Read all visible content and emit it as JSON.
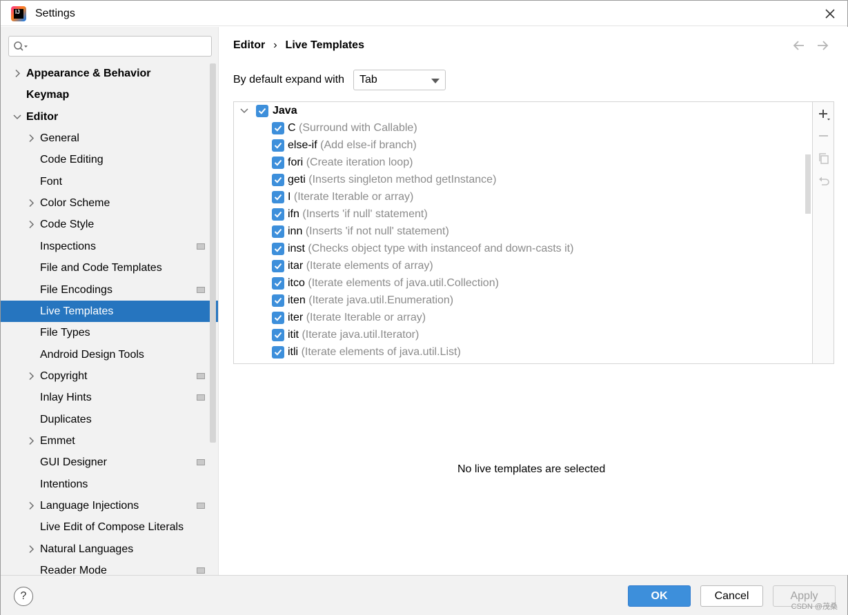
{
  "window": {
    "title": "Settings"
  },
  "sidebar": {
    "search_placeholder": "",
    "items": [
      {
        "label": "Appearance & Behavior",
        "bold": true,
        "expandable": true,
        "expanded": false,
        "level": 0,
        "has_project_icon": false
      },
      {
        "label": "Keymap",
        "bold": true,
        "expandable": false,
        "level": 0,
        "has_project_icon": false
      },
      {
        "label": "Editor",
        "bold": true,
        "expandable": true,
        "expanded": true,
        "level": 0,
        "has_project_icon": false
      },
      {
        "label": "General",
        "bold": false,
        "expandable": true,
        "expanded": false,
        "level": 1,
        "has_project_icon": false
      },
      {
        "label": "Code Editing",
        "bold": false,
        "expandable": false,
        "level": 1,
        "has_project_icon": false
      },
      {
        "label": "Font",
        "bold": false,
        "expandable": false,
        "level": 1,
        "has_project_icon": false
      },
      {
        "label": "Color Scheme",
        "bold": false,
        "expandable": true,
        "expanded": false,
        "level": 1,
        "has_project_icon": false
      },
      {
        "label": "Code Style",
        "bold": false,
        "expandable": true,
        "expanded": false,
        "level": 1,
        "has_project_icon": false
      },
      {
        "label": "Inspections",
        "bold": false,
        "expandable": false,
        "level": 1,
        "has_project_icon": true
      },
      {
        "label": "File and Code Templates",
        "bold": false,
        "expandable": false,
        "level": 1,
        "has_project_icon": false
      },
      {
        "label": "File Encodings",
        "bold": false,
        "expandable": false,
        "level": 1,
        "has_project_icon": true
      },
      {
        "label": "Live Templates",
        "bold": false,
        "expandable": false,
        "level": 1,
        "has_project_icon": false,
        "selected": true
      },
      {
        "label": "File Types",
        "bold": false,
        "expandable": false,
        "level": 1,
        "has_project_icon": false
      },
      {
        "label": "Android Design Tools",
        "bold": false,
        "expandable": false,
        "level": 1,
        "has_project_icon": false
      },
      {
        "label": "Copyright",
        "bold": false,
        "expandable": true,
        "expanded": false,
        "level": 1,
        "has_project_icon": true
      },
      {
        "label": "Inlay Hints",
        "bold": false,
        "expandable": false,
        "level": 1,
        "has_project_icon": true
      },
      {
        "label": "Duplicates",
        "bold": false,
        "expandable": false,
        "level": 1,
        "has_project_icon": false
      },
      {
        "label": "Emmet",
        "bold": false,
        "expandable": true,
        "expanded": false,
        "level": 1,
        "has_project_icon": false
      },
      {
        "label": "GUI Designer",
        "bold": false,
        "expandable": false,
        "level": 1,
        "has_project_icon": true
      },
      {
        "label": "Intentions",
        "bold": false,
        "expandable": false,
        "level": 1,
        "has_project_icon": false
      },
      {
        "label": "Language Injections",
        "bold": false,
        "expandable": true,
        "expanded": false,
        "level": 1,
        "has_project_icon": true
      },
      {
        "label": "Live Edit of Compose Literals",
        "bold": false,
        "expandable": false,
        "level": 1,
        "has_project_icon": false
      },
      {
        "label": "Natural Languages",
        "bold": false,
        "expandable": true,
        "expanded": false,
        "level": 1,
        "has_project_icon": false
      },
      {
        "label": "Reader Mode",
        "bold": false,
        "expandable": false,
        "level": 1,
        "has_project_icon": true
      }
    ]
  },
  "breadcrumb": {
    "parent": "Editor",
    "separator": "›",
    "current": "Live Templates"
  },
  "expand": {
    "label": "By default expand with",
    "value": "Tab"
  },
  "templates": {
    "group": {
      "name": "Java",
      "checked": true,
      "expanded": true
    },
    "items": [
      {
        "abbr": "C",
        "desc": "(Surround with Callable)",
        "checked": true
      },
      {
        "abbr": "else-if",
        "desc": "(Add else-if branch)",
        "checked": true
      },
      {
        "abbr": "fori",
        "desc": "(Create iteration loop)",
        "checked": true
      },
      {
        "abbr": "geti",
        "desc": "(Inserts singleton method getInstance)",
        "checked": true
      },
      {
        "abbr": "I",
        "desc": "(Iterate Iterable or array)",
        "checked": true
      },
      {
        "abbr": "ifn",
        "desc": "(Inserts 'if null' statement)",
        "checked": true
      },
      {
        "abbr": "inn",
        "desc": "(Inserts 'if not null' statement)",
        "checked": true
      },
      {
        "abbr": "inst",
        "desc": "(Checks object type with instanceof and down-casts it)",
        "checked": true
      },
      {
        "abbr": "itar",
        "desc": "(Iterate elements of array)",
        "checked": true
      },
      {
        "abbr": "itco",
        "desc": "(Iterate elements of java.util.Collection)",
        "checked": true
      },
      {
        "abbr": "iten",
        "desc": "(Iterate java.util.Enumeration)",
        "checked": true
      },
      {
        "abbr": "iter",
        "desc": "(Iterate Iterable or array)",
        "checked": true
      },
      {
        "abbr": "itit",
        "desc": "(Iterate java.util.Iterator)",
        "checked": true
      },
      {
        "abbr": "itli",
        "desc": "(Iterate elements of java.util.List)",
        "checked": true
      }
    ]
  },
  "tools": {
    "add_icon": "plus-icon",
    "remove_icon": "minus-icon",
    "copy_icon": "copy-icon",
    "restore_icon": "undo-icon"
  },
  "empty_message": "No live templates are selected",
  "buttons": {
    "help": "?",
    "ok": "OK",
    "cancel": "Cancel",
    "apply": "Apply"
  },
  "watermark": "CSDN @茂桑",
  "colors": {
    "selection": "#2675bf",
    "checkbox": "#3d8fdb",
    "primary_button": "#3d8fdb",
    "description_text": "#8b8b8b"
  }
}
